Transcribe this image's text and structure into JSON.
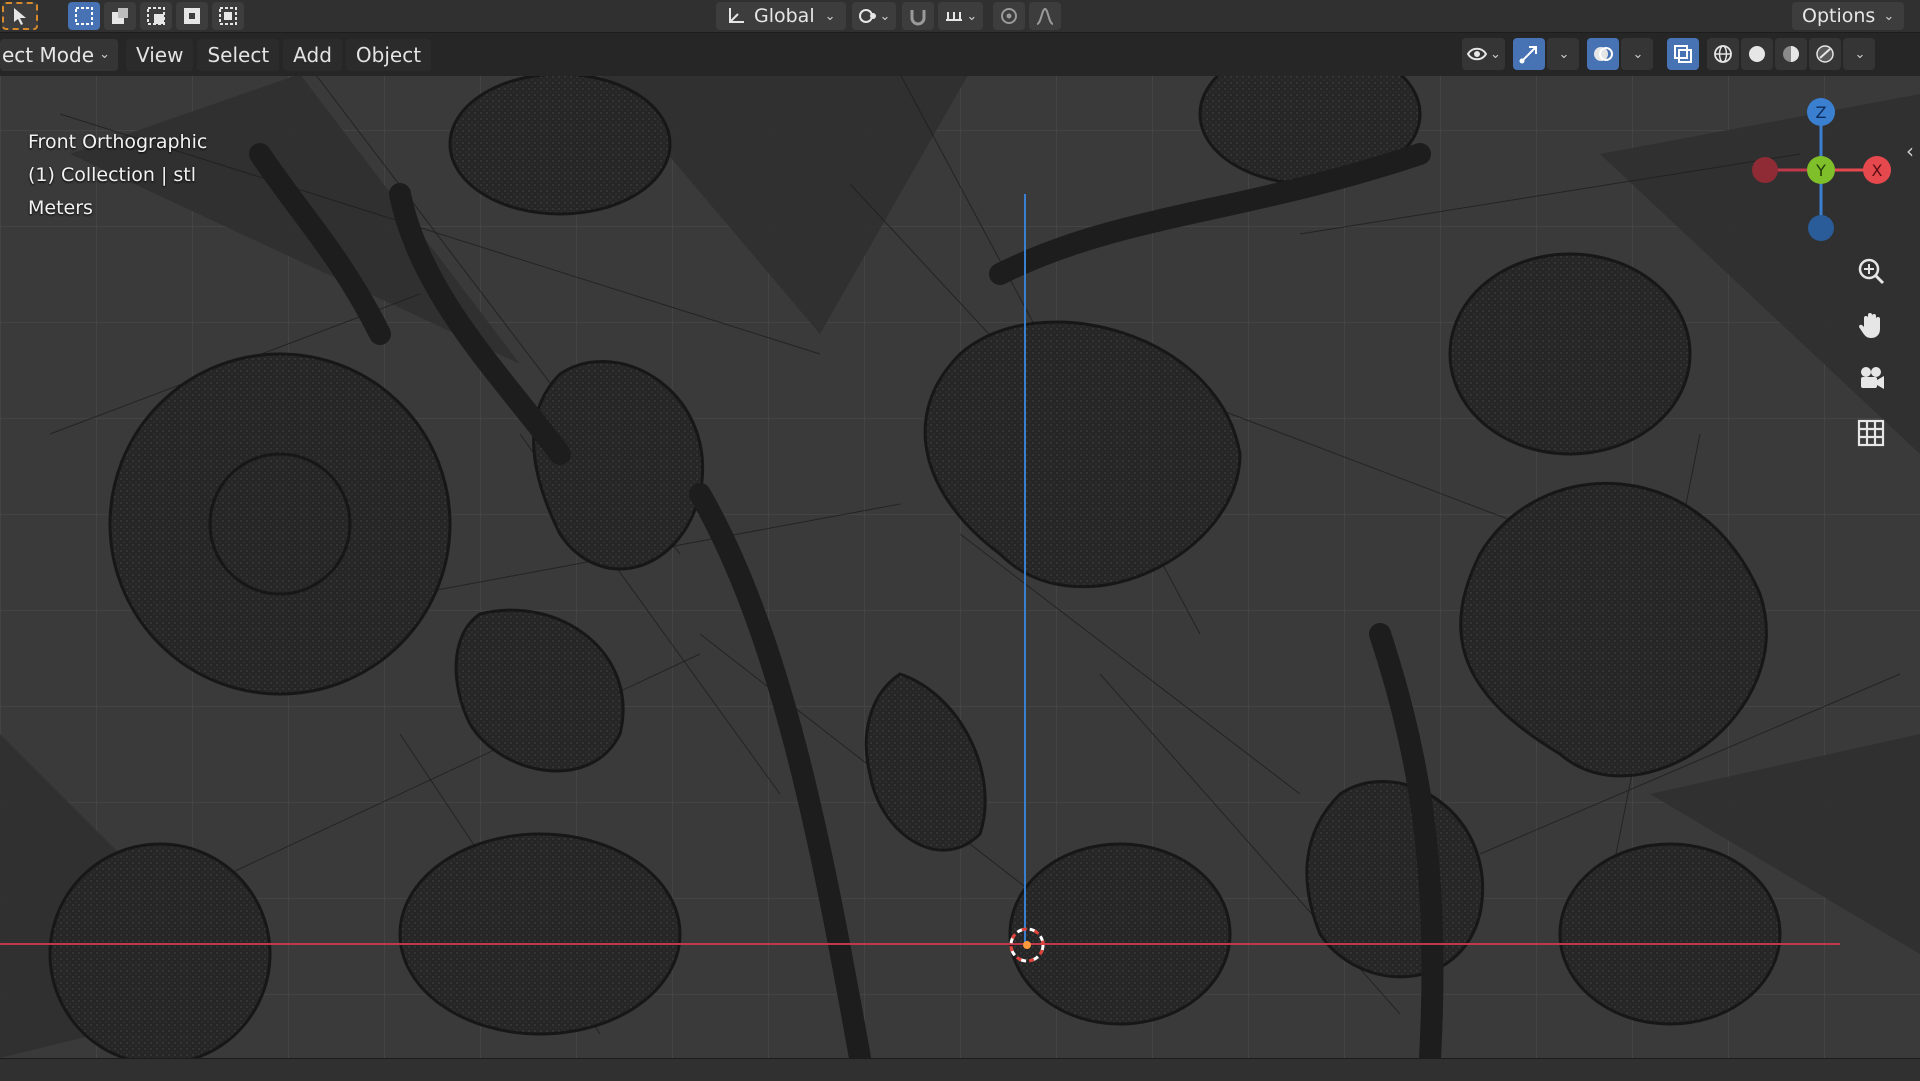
{
  "toolbar": {
    "global_label": "Global",
    "options_label": "Options"
  },
  "header": {
    "mode_label": "ect Mode",
    "menus": [
      "View",
      "Select",
      "Add",
      "Object"
    ]
  },
  "viewport_info": {
    "view_name": "Front Orthographic",
    "collection": "(1) Collection | stl",
    "units": "Meters"
  },
  "gizmo": {
    "z_label": "Z",
    "y_label": "Y",
    "x_label": "X"
  },
  "colors": {
    "accent": "#4772b3",
    "x_axis": "#e5484d",
    "y_axis": "#7fbf2a",
    "z_axis": "#3b7fd1"
  }
}
